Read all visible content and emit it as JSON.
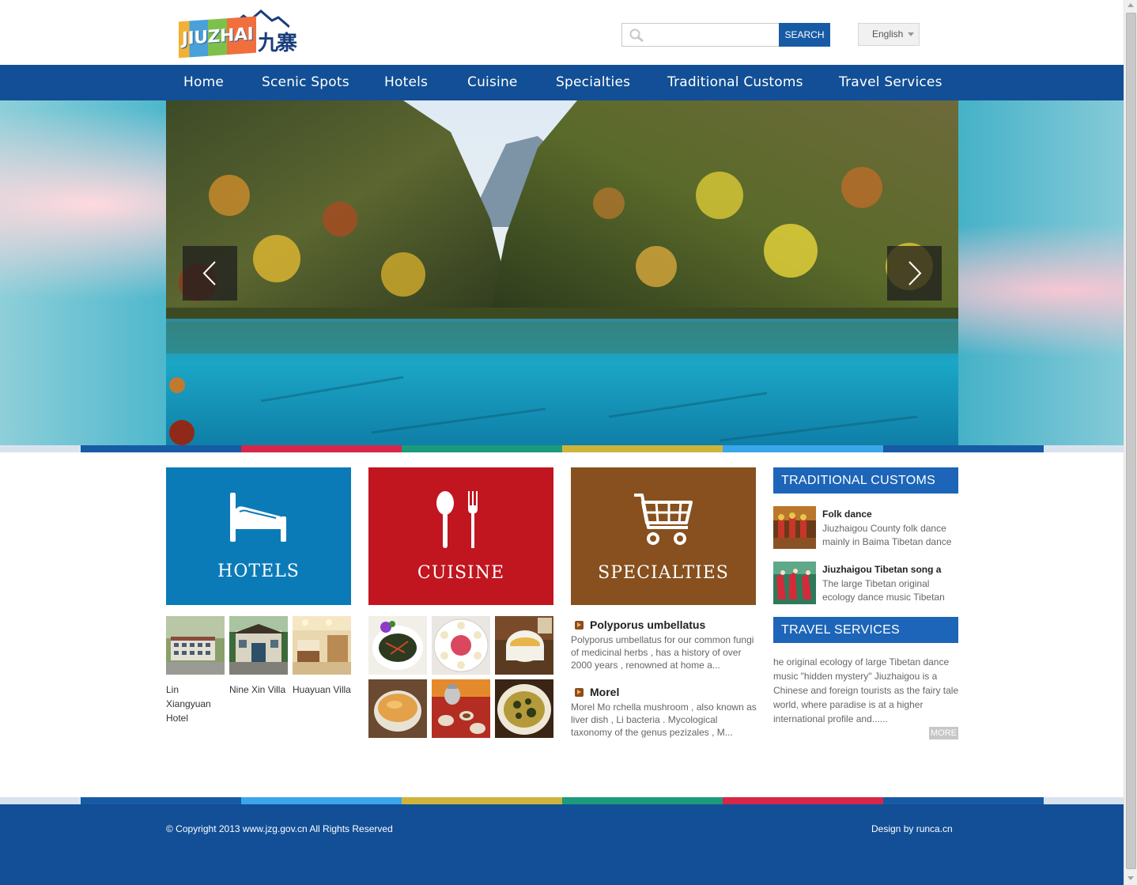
{
  "header": {
    "logo_text": "JIUZHAI",
    "logo_cn": "九寨",
    "search": {
      "placeholder": "",
      "value": "",
      "button_label": "SEARCH"
    },
    "language": "English"
  },
  "nav": {
    "items": [
      {
        "label": "Home"
      },
      {
        "label": "Scenic Spots"
      },
      {
        "label": "Hotels"
      },
      {
        "label": "Cuisine"
      },
      {
        "label": "Specialties"
      },
      {
        "label": "Traditional Customs"
      },
      {
        "label": "Travel Services"
      }
    ]
  },
  "hero": {
    "prev_icon": "chevron-left-icon",
    "next_icon": "chevron-right-icon"
  },
  "stripe_colors": [
    "#175ba5",
    "#d7264a",
    "#1c9b7c",
    "#cfb43c",
    "#3ba6ea",
    "#175ba5"
  ],
  "footer_stripe_colors": [
    "#175ba5",
    "#3ba6ea",
    "#cfb43c",
    "#1c9b7c",
    "#d7264a",
    "#175ba5"
  ],
  "tiles": {
    "hotels": {
      "label": "HOTELS",
      "color": "#0b7bb8",
      "icon": "bed-icon"
    },
    "cuisine": {
      "label": "CUISINE",
      "color": "#c1151f",
      "icon": "spoon-fork-icon"
    },
    "specialties": {
      "label": "SPECIALTIES",
      "color": "#87501e",
      "icon": "cart-icon"
    }
  },
  "hotels": [
    {
      "name": "Lin Xiangyuan Hotel"
    },
    {
      "name": "Nine Xin Villa"
    },
    {
      "name": "Huayuan Villa"
    }
  ],
  "specialties": [
    {
      "title": "Polyporus umbellatus",
      "desc": "Polyporus umbellatus for our common fungi of medicinal herbs , has a history of over 2000 years , renowned at home a..."
    },
    {
      "title": "Morel",
      "desc": "Morel Mo rchella mushroom , also known as liver dish , Li bacteria . Mycological taxonomy of the genus pezizales , M..."
    }
  ],
  "customs": {
    "heading": "TRADITIONAL CUSTOMS",
    "items": [
      {
        "title": "Folk dance",
        "desc": "Jiuzhaigou County folk dance mainly in Baima Tibetan dance"
      },
      {
        "title": "Jiuzhaigou Tibetan song a",
        "desc": "The large Tibetan original ecology dance music Tibetan"
      }
    ]
  },
  "travel": {
    "heading": "TRAVEL SERVICES",
    "desc": "he original ecology of large Tibetan dance music \"hidden mystery\" Jiuzhaigou is a Chinese and foreign tourists as the fairy tale world, where paradise is at a higher international profile and......",
    "more": "MORE"
  },
  "footer": {
    "copyright": "© Copyright 2013 www.jzg.gov.cn All Rights Reserved",
    "design": "Design by  runca.cn"
  }
}
